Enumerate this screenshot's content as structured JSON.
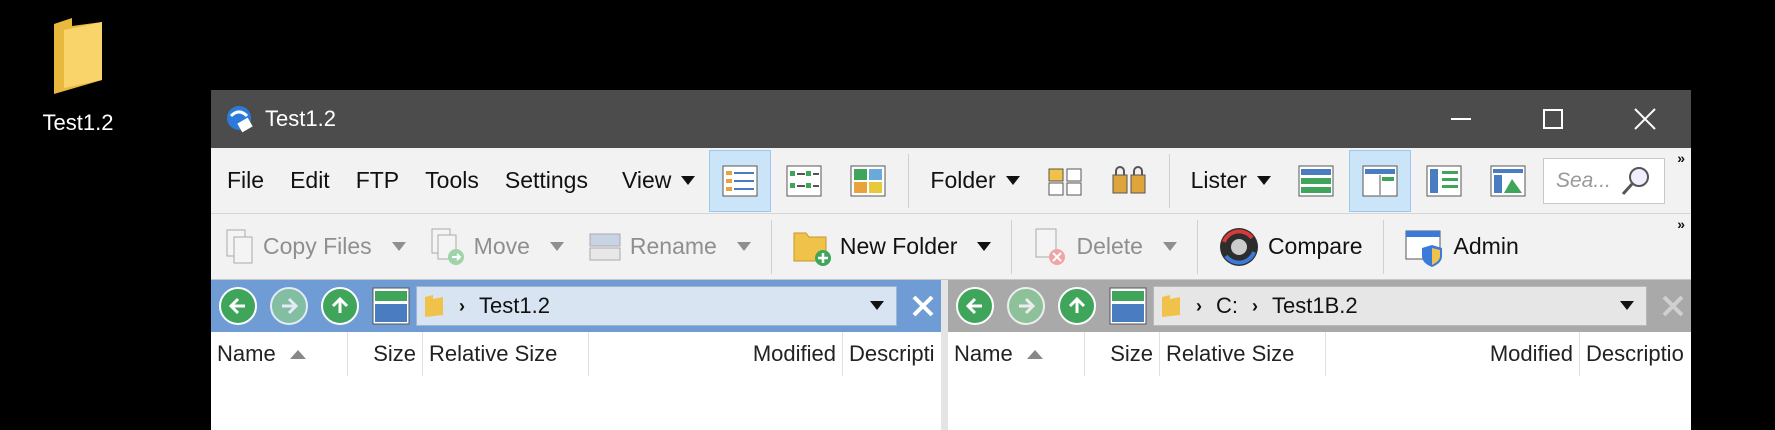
{
  "desktop": {
    "icon_label": "Test1.2"
  },
  "window": {
    "title": "Test1.2",
    "controls": {
      "minimize": "minimize",
      "maximize": "maximize",
      "close": "close"
    }
  },
  "menu": {
    "items": [
      "File",
      "Edit",
      "FTP",
      "Tools",
      "Settings"
    ],
    "view": "View",
    "folder": "Folder",
    "lister": "Lister",
    "search_placeholder": "Sea..."
  },
  "toolbar": {
    "copy_files": "Copy Files",
    "move": "Move",
    "rename": "Rename",
    "new_folder": "New Folder",
    "delete": "Delete",
    "compare": "Compare",
    "admin": "Admin"
  },
  "left_pane": {
    "path": [
      "Test1.2"
    ],
    "columns": [
      "Name",
      "Size",
      "Relative Size",
      "Modified",
      "Descripti"
    ]
  },
  "right_pane": {
    "path": [
      "C:",
      "Test1B.2"
    ],
    "columns": [
      "Name",
      "Size",
      "Relative Size",
      "Modified",
      "Descriptio"
    ]
  },
  "colors": {
    "titlebar": "#4c4c4c",
    "left_pathbar": "#6f9cd4",
    "right_pathbar": "#a9a9a9",
    "nav_green": "#3fa55a",
    "selected_highlight": "#cce4f7"
  }
}
